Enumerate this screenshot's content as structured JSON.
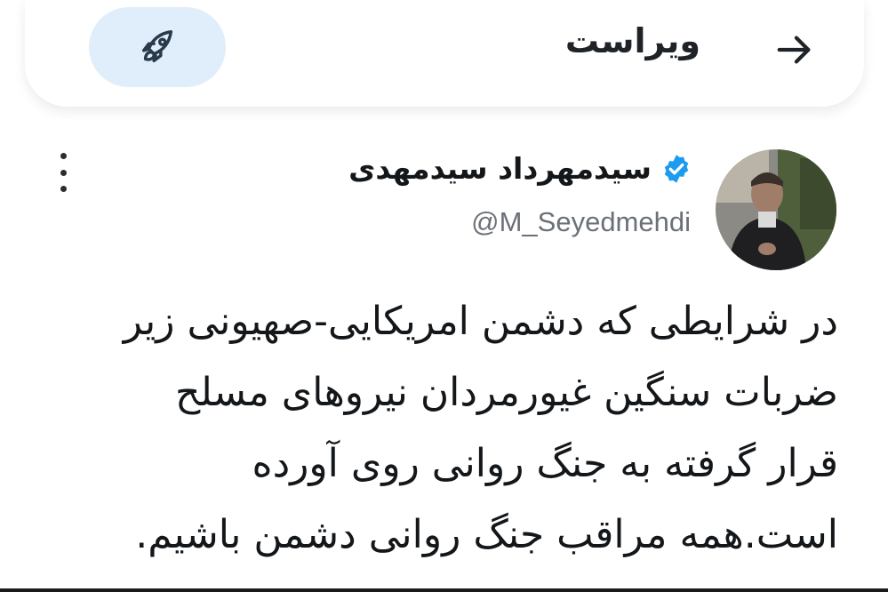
{
  "header": {
    "title": "ویراست",
    "back_icon": "arrow-right-icon",
    "boost_icon": "rocket-icon"
  },
  "tweet": {
    "author_name": "سیدمهرداد سیدمهدی",
    "verified": true,
    "handle": "@M_Seyedmehdi",
    "more_icon": "more-vertical-icon",
    "text": "در شرایطی که دشمن امریکایی-صهیونی زیر\nضربات سنگین  غیورمردان نیروهای مسلح\nقرار گرفته به جنگ روانی روی آورده\nاست.همه مراقب جنگ روانی دشمن باشیم."
  },
  "colors": {
    "accent": "#1d9bf0",
    "boost_bg": "#dfeefa",
    "text": "#14171a",
    "muted": "#6b7177"
  }
}
